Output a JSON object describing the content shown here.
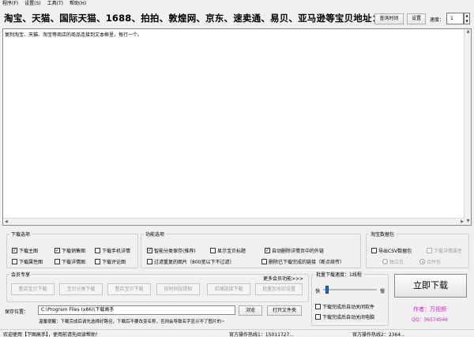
{
  "menu": [
    "程序(F)",
    "设置(S)",
    "工具(T)",
    "帮助(H)"
  ],
  "header": {
    "title": "淘宝、天猫、国际天猫、1688、拍拍、敦煌网、京东、速卖通、易贝、亚马逊等宝贝地址：",
    "time_btn": "查询时间",
    "settings_btn": "设置",
    "speed_label": "速度：",
    "speed_value": "1"
  },
  "textarea": {
    "hint": "复制淘宝、天猫、淘宝等商店的商品连接到文本框里，每行一个。"
  },
  "download_options": {
    "legend": "下载选项",
    "items": [
      {
        "label": "下载主图",
        "checked": true
      },
      {
        "label": "下载销售图",
        "checked": true
      },
      {
        "label": "下载手机详情",
        "checked": false
      },
      {
        "label": "下载属性图",
        "checked": false
      },
      {
        "label": "下载详情图",
        "checked": false
      },
      {
        "label": "下载评论图",
        "checked": false
      }
    ]
  },
  "function_options": {
    "legend": "功能选项",
    "items": [
      {
        "label": "智能分类保存(推荐)",
        "checked": true
      },
      {
        "label": "显示宝贝标题",
        "checked": false
      },
      {
        "label": "自动删除详情页中的外链",
        "checked": true
      },
      {
        "label": "过滤重复的图片（800宽以下不过滤）",
        "checked": false
      },
      {
        "label": "删除已下载完成的链接（断点续传）",
        "checked": false
      }
    ]
  },
  "mode": {
    "legend": "淘宝数据包",
    "export_csv": "导出CSV数据包",
    "download_thumb": "下载详情属性",
    "radio_single": "独立包",
    "radio_merge": "合并包"
  },
  "members": {
    "legend": "会员专享",
    "more": "更多会员功能>>>",
    "buttons": [
      "整店宝贝下载",
      "宝贝分类下载",
      "整店宝贝下载",
      "按时间段提取",
      "店铺链接下载",
      "批量加水印设置"
    ]
  },
  "batch": {
    "legend": "批量下载速度：1线程",
    "slow": "快",
    "fast": "慢",
    "speed_fraction": 0.05,
    "auto_close": "下载完成后自动关闭软件",
    "auto_shutdown": "下载完成后自动关闭电脑"
  },
  "save": {
    "label": "保存位置：",
    "path": "C:\\Program Files (x86)\\下载高手",
    "browse": "浏览",
    "open": "打开文件夹",
    "warning": "温馨提醒：下载完成后请先选择好路径，下载后不要改变名称，否则会导致名字显示不了图片的~"
  },
  "download_button": "立即下载",
  "author": "作者：万视频",
  "qq": "QQ：36574546",
  "status": {
    "left": "欢迎使用【下图高手】，使用前请先阅读帮助！",
    "mid": "官方操作热线1：15011727...",
    "right": "官方操作热线2：2364..."
  },
  "colors": {
    "author": "#d71ec8",
    "slider": "#1e6fd9"
  }
}
